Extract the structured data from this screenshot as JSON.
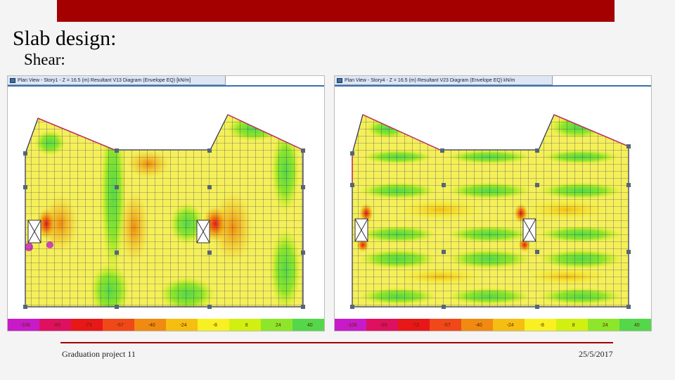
{
  "slide": {
    "title": "Slab design:",
    "subtitle": "Shear:",
    "footer_left": "Graduation project 11",
    "footer_right": "25/5/2017"
  },
  "panels": [
    {
      "window_title": "Plan View - Story1 - Z = 16.5 (m)    Resultant V13 Diagram    (Envelope EQ)  [kN/m]",
      "legend_values": [
        "-106",
        "-89",
        "-73",
        "-57",
        "-40",
        "-24",
        "-8",
        "8",
        "24",
        "40"
      ]
    },
    {
      "window_title": "Plan View - Story4 - Z = 16.5 (m)    Resultant V23 Diagram    (Envelope EQ)  kN/m",
      "legend_values": [
        "-106",
        "-89",
        "-73",
        "-57",
        "-40",
        "-24",
        "-8",
        "8",
        "24",
        "40"
      ]
    }
  ],
  "legend_colors": [
    "#c81ac8",
    "#e01060",
    "#e81818",
    "#f04818",
    "#f08a10",
    "#f5be10",
    "#f8f020",
    "#d2f010",
    "#8ee62a",
    "#54d84a"
  ],
  "colors": {
    "accent": "#a40000",
    "slab_base": "#f5f05a"
  }
}
